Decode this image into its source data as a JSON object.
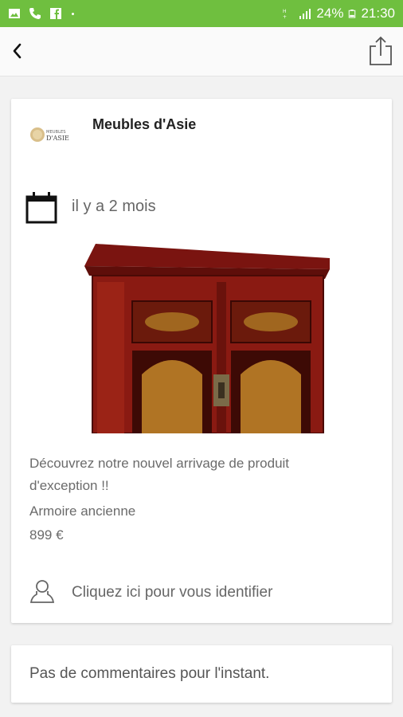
{
  "status_bar": {
    "battery": "24%",
    "time": "21:30",
    "icons": [
      "image-icon",
      "phone-icon",
      "facebook-icon",
      "signal-icon",
      "battery-icon"
    ]
  },
  "app_bar": {
    "back_icon": "chevron-left-icon",
    "share_icon": "share-icon"
  },
  "post": {
    "author": "Meubles d'Asie",
    "logo_text_top": "MEUBLES",
    "logo_text_bottom": "D'ASIE",
    "date": "il y a 2 mois",
    "description_line1": "Découvrez notre nouvel arrivage de produit",
    "description_line2": "d'exception !!",
    "product_name": "Armoire ancienne",
    "price": "899 €",
    "login_prompt": "Cliquez ici pour vous identifier"
  },
  "comments": {
    "empty_text": "Pas de commentaires pour l'instant."
  },
  "colors": {
    "status_bar": "#6fbf3f",
    "cabinet_red": "#8a1a12"
  }
}
